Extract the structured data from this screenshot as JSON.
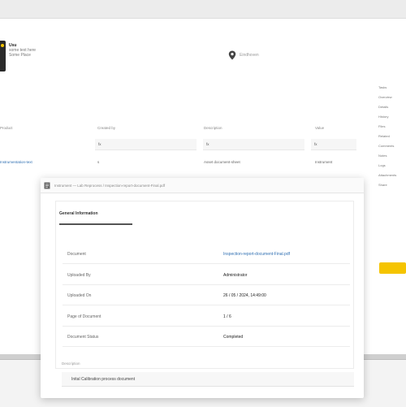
{
  "company": {
    "name": "Usu",
    "line1": "some text here",
    "line2": "Some Place"
  },
  "location": {
    "text": "Eindhoven"
  },
  "grid": {
    "headers": [
      "Product",
      "Created by",
      "Description",
      "Value"
    ],
    "inputs": [
      "fx",
      "fx",
      "fx"
    ],
    "row": {
      "link": "Instrumentation-text",
      "cells": [
        "s",
        "Asset document-sheet",
        "Instrument"
      ]
    }
  },
  "modal": {
    "header_title": "Instrument — Lab Reprocess / Inspection-report-document-Final.pdf",
    "tab_label": "General Information",
    "fields": [
      {
        "label": "Document",
        "value": "Inspection-report-document-Final.pdf"
      },
      {
        "label": "Uploaded By",
        "value": "Administrator"
      },
      {
        "label": "Uploaded On",
        "value": "26 / 05 / 2024, 14:49:00"
      },
      {
        "label": "Page of Document",
        "value": "1 / 6"
      },
      {
        "label": "Document Status",
        "value": "Completed"
      }
    ],
    "description_label": "Description",
    "description_value": "Inital Calibration process document"
  },
  "right_panel": {
    "items": [
      "Tasks",
      "Overview",
      "Details",
      "History",
      "Files",
      "Related",
      "Comments",
      "Notes",
      "Logs",
      "Attachments",
      "Share"
    ]
  },
  "colors": {
    "accent": "#f5c400",
    "link": "#2f6fb2"
  }
}
